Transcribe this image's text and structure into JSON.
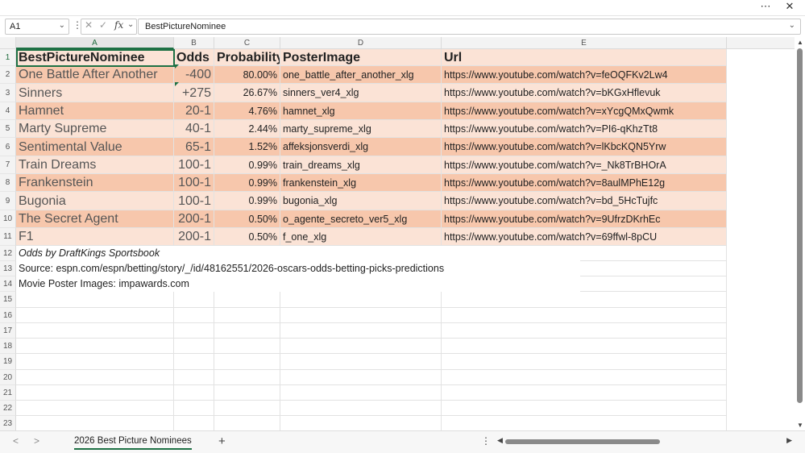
{
  "window": {
    "more_icon": "more-horizontal-icon",
    "close_icon": "close-icon"
  },
  "formula_bar": {
    "name_box": "A1",
    "formula": "BestPictureNominee"
  },
  "columns": [
    "A",
    "B",
    "C",
    "D",
    "E"
  ],
  "rows": [
    "1",
    "2",
    "3",
    "4",
    "5",
    "6",
    "7",
    "8",
    "9",
    "10",
    "11",
    "12",
    "13",
    "14",
    "15",
    "16",
    "17",
    "18",
    "19",
    "20",
    "21",
    "22",
    "23"
  ],
  "table": {
    "headers": [
      "BestPictureNominee",
      "Odds",
      "Probability",
      "PosterImage",
      "Url"
    ],
    "rows": [
      [
        "One Battle After Another",
        "-400",
        "80.00%",
        "one_battle_after_another_xlg",
        "https://www.youtube.com/watch?v=feOQFKv2Lw4"
      ],
      [
        "Sinners",
        "+275",
        "26.67%",
        "sinners_ver4_xlg",
        "https://www.youtube.com/watch?v=bKGxHflevuk"
      ],
      [
        "Hamnet",
        "20-1",
        "4.76%",
        "hamnet_xlg",
        "https://www.youtube.com/watch?v=xYcgQMxQwmk"
      ],
      [
        "Marty Supreme",
        "40-1",
        "2.44%",
        "marty_supreme_xlg",
        "https://www.youtube.com/watch?v=PI6-qKhzTt8"
      ],
      [
        "Sentimental Value",
        "65-1",
        "1.52%",
        "affeksjonsverdi_xlg",
        "https://www.youtube.com/watch?v=lKbcKQN5Yrw"
      ],
      [
        "Train Dreams",
        "100-1",
        "0.99%",
        "train_dreams_xlg",
        "https://www.youtube.com/watch?v=_Nk8TrBHOrA"
      ],
      [
        "Frankenstein",
        "100-1",
        "0.99%",
        "frankenstein_xlg",
        "https://www.youtube.com/watch?v=8aulMPhE12g"
      ],
      [
        "Bugonia",
        "100-1",
        "0.99%",
        "bugonia_xlg",
        "https://www.youtube.com/watch?v=bd_5HcTujfc"
      ],
      [
        "The Secret Agent",
        "200-1",
        "0.50%",
        "o_agente_secreto_ver5_xlg",
        "https://www.youtube.com/watch?v=9UfrzDKrhEc"
      ],
      [
        "F1",
        "200-1",
        "0.50%",
        "f_one_xlg",
        "https://www.youtube.com/watch?v=69ffwl-8pCU"
      ]
    ]
  },
  "notes": [
    "Odds by DraftKings Sportsbook",
    "Source: espn.com/espn/betting/story/_/id/48162551/2026-oscars-odds-betting-picks-predictions",
    "Movie Poster Images: impawards.com"
  ],
  "sheet_tab": "2026 Best Picture Nominees",
  "colors": {
    "header_bg": "#fbe3d6",
    "band_dark": "#f7c7ac",
    "band_light": "#fbe3d6",
    "text_grey": "#555555",
    "text_dark": "#222222",
    "accent": "#1e7145"
  }
}
